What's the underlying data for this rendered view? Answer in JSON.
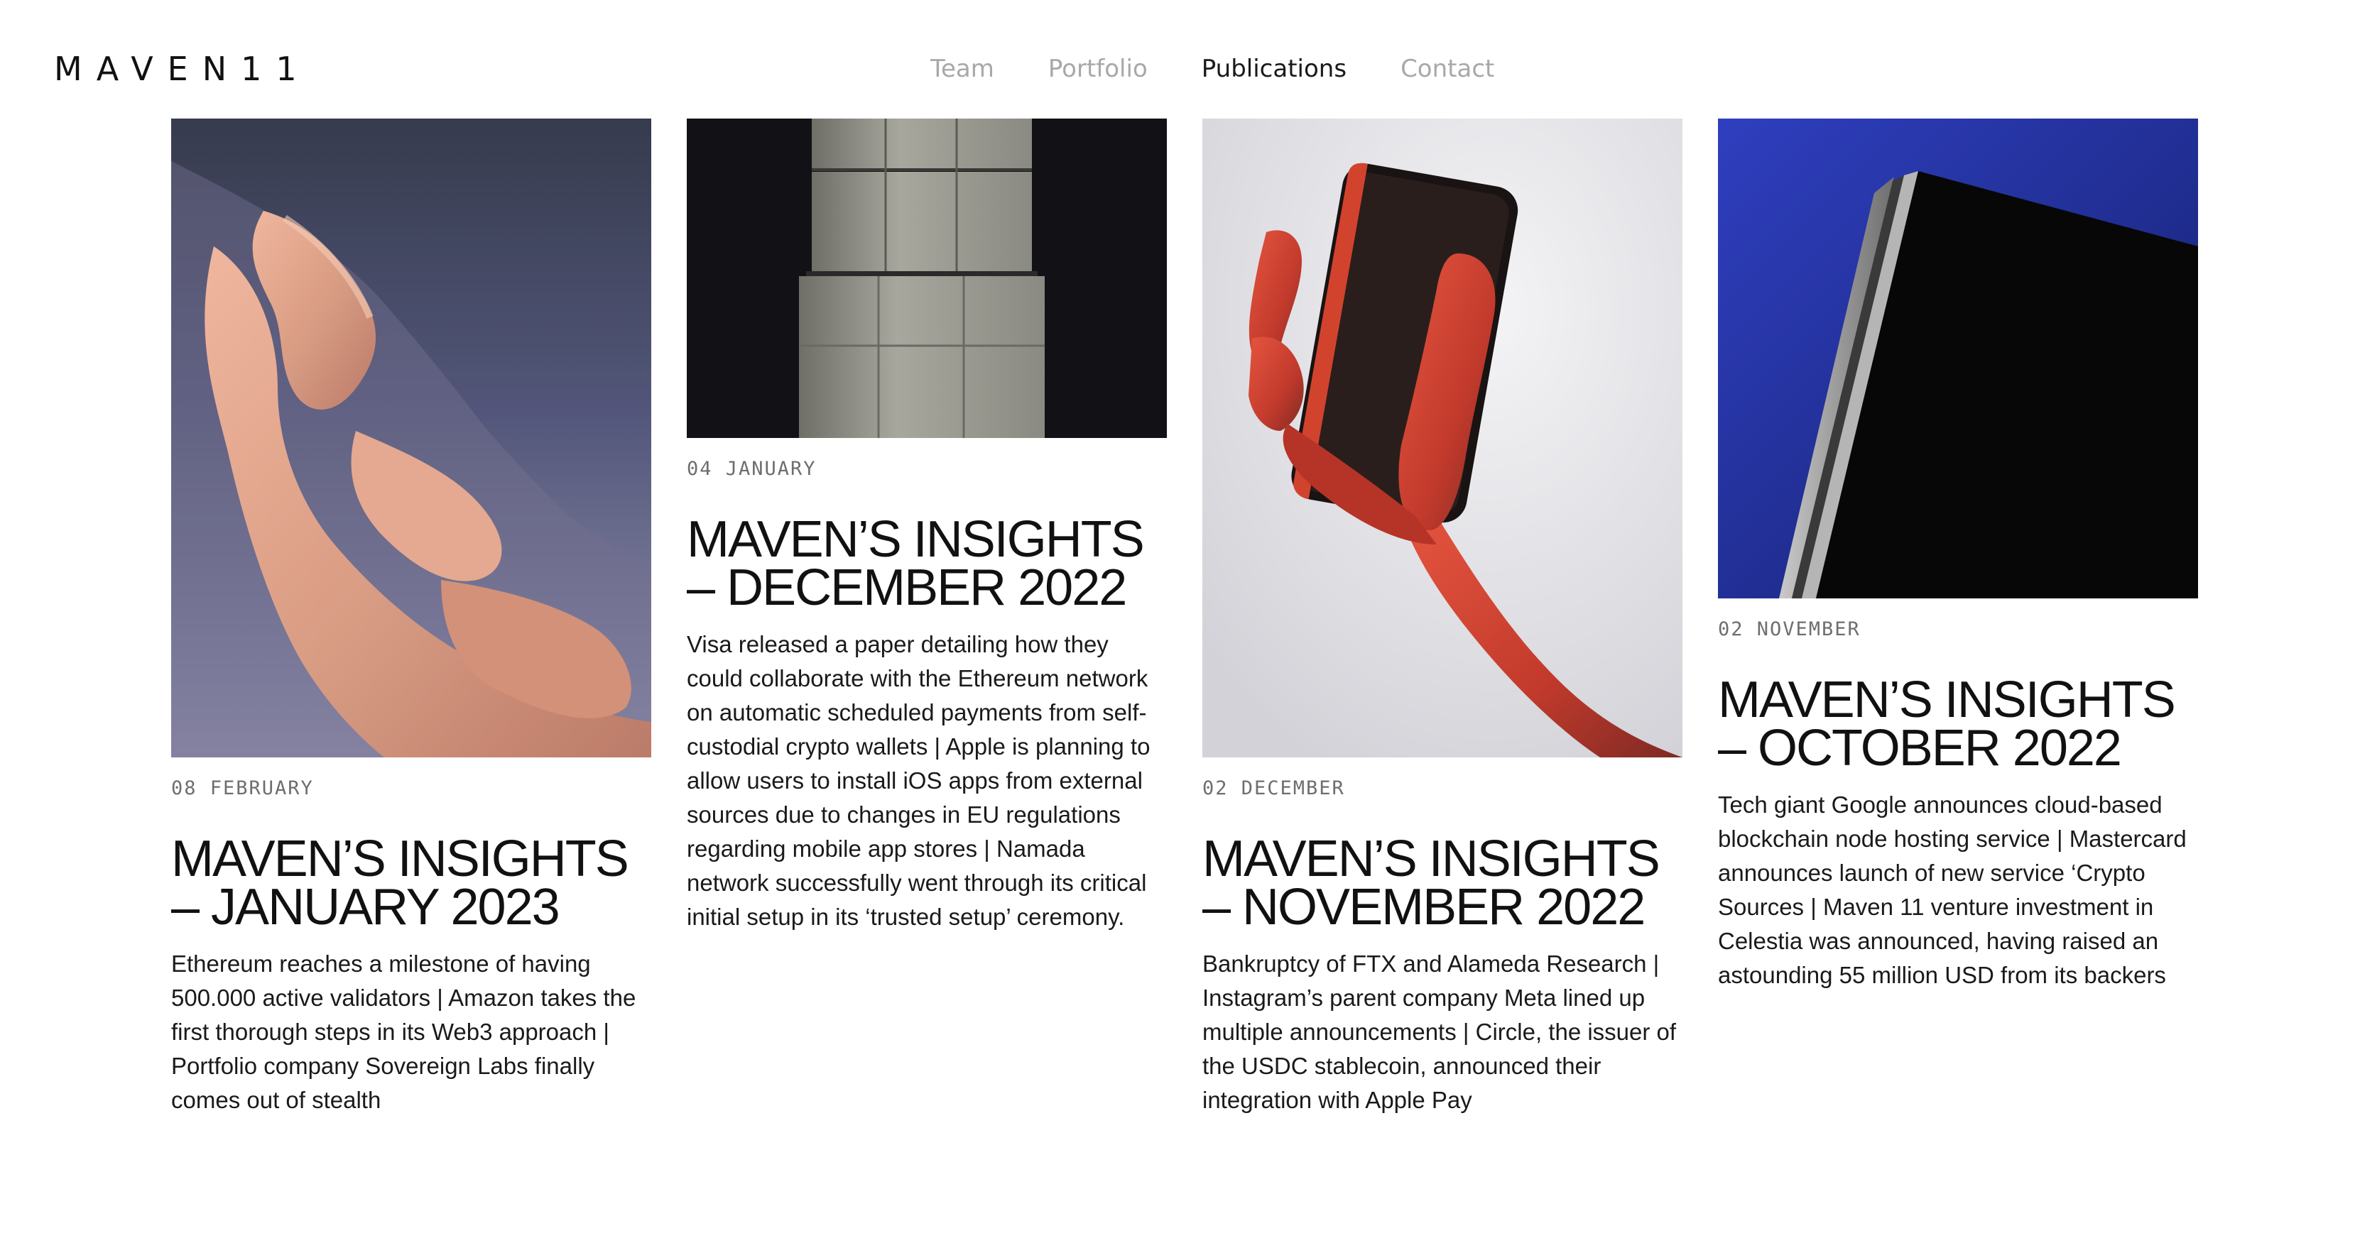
{
  "header": {
    "logo": "MAVEN11",
    "nav": [
      {
        "label": "Team",
        "active": false
      },
      {
        "label": "Portfolio",
        "active": false
      },
      {
        "label": "Publications",
        "active": true
      },
      {
        "label": "Contact",
        "active": false
      }
    ]
  },
  "posts": [
    {
      "date": "08 FEBRUARY",
      "title": "MAVEN’S INSIGHTS – JANUARY 2023",
      "excerpt": "Ethereum reaches a milestone of having 500.000 active validators | Amazon takes the first thorough steps in its Web3 approach | Portfolio company Sovereign Labs finally comes out of stealth",
      "image": "fingers-photo"
    },
    {
      "date": "04 JANUARY",
      "title": "MAVEN’S INSIGHTS – DECEMBER 2022",
      "excerpt": "Visa released a paper detailing how they could collaborate with the Ethereum network on automatic scheduled payments from self-custodial crypto wallets | Apple is planning to allow users to install iOS apps from external sources due to changes in EU regulations regarding mobile app stores | Namada network successfully went through its critical initial setup in its ‘trusted setup’ ceremony.",
      "image": "stacked-blocks-photo"
    },
    {
      "date": "02 DECEMBER",
      "title": "MAVEN’S INSIGHTS – NOVEMBER 2022",
      "excerpt": "Bankruptcy of FTX and Alameda Research | Instagram’s parent company Meta lined up multiple announcements | Circle, the issuer of the USDC stablecoin, announced their integration with Apple Pay",
      "image": "hand-holding-phone-photo"
    },
    {
      "date": "02 NOVEMBER",
      "title": "MAVEN’S INSIGHTS – OCTOBER 2022",
      "excerpt": "Tech giant Google announces cloud-based blockchain node hosting service | Mastercard announces launch of new service ‘Crypto Sources | Maven 11 venture investment in Celestia was announced, having raised an astounding 55 million USD from its backers",
      "image": "monolith-photo"
    }
  ]
}
